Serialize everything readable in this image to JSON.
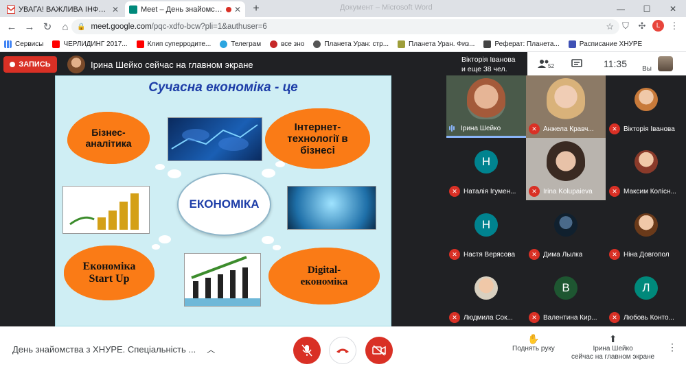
{
  "tabs": [
    {
      "title": "УВАГА! ВАЖЛИВА ІНФОРМАЦІЯ",
      "favicon_color": "#d93025",
      "active": false
    },
    {
      "title": "Meet – День знайомства з ХНУРЕ",
      "favicon_color": "#00897b",
      "active": true
    }
  ],
  "ghost_title": "Документ – Microsoft Word",
  "address": {
    "host": "meet.google.com",
    "path": "/pqc-xdfo-bcw?pli=1&authuser=6"
  },
  "profile_letter": "L",
  "bookmarks": [
    {
      "label": "Сервисы",
      "color": "#4285f4"
    },
    {
      "label": "ЧЕРЛИДИНГ 2017...",
      "color": "#ff0000"
    },
    {
      "label": "Клип суперродите...",
      "color": "#ff0000"
    },
    {
      "label": "Телеграм",
      "color": "#2ca5e0"
    },
    {
      "label": "все зно",
      "color": "#c62828"
    },
    {
      "label": "Планета Уран: стр...",
      "color": "#555555"
    },
    {
      "label": "Планета Уран. Физ...",
      "color": "#9e9e3a"
    },
    {
      "label": "Реферат: Планета...",
      "color": "#444444"
    },
    {
      "label": "Расписание ХНУРЕ",
      "color": "#3f51b5"
    }
  ],
  "meet": {
    "record_label": "ЗАПИСЬ",
    "presenter_banner": "Ірина Шейко сейчас на главном экране",
    "participants_line1": "Вікторія Іванова",
    "participants_line2": "и еще 38 чел.",
    "people_count": "52",
    "clock": "11:35",
    "you_label": "Вы",
    "colors": {
      "accent": "#d93025",
      "tile": "#3c4043",
      "bg": "#202124"
    }
  },
  "slide": {
    "title": "Сучасна економіка - це",
    "center": "ЕКОНОМІКА",
    "clouds": [
      "Бізнес-\nаналітика",
      "Інтернет-\nтехнології в\nбізнесі",
      "Економіка\nStart Up",
      "Digital-\nекономіка"
    ]
  },
  "tiles": [
    {
      "name": "Ірина Шейко",
      "type": "video",
      "muted": false,
      "speaking": true
    },
    {
      "name": "Анжела Кравч...",
      "type": "video",
      "muted": true
    },
    {
      "name": "Вікторія Іванова",
      "type": "photo",
      "muted": true
    },
    {
      "name": "Наталія Ігумен...",
      "type": "letter",
      "letter": "Н",
      "color": "#00838f",
      "muted": true
    },
    {
      "name": "Irina Kolupaieva",
      "type": "video",
      "muted": true
    },
    {
      "name": "Максим Колісн...",
      "type": "photo",
      "muted": true
    },
    {
      "name": "Настя Верясова",
      "type": "letter",
      "letter": "Н",
      "color": "#00838f",
      "muted": true
    },
    {
      "name": "Дима Лылка",
      "type": "photo",
      "muted": true
    },
    {
      "name": "Ніна Довгопол",
      "type": "photo",
      "muted": true
    },
    {
      "name": "Людмила Сок...",
      "type": "photo",
      "muted": true
    },
    {
      "name": "Валентина Кир...",
      "type": "letter",
      "letter": "В",
      "color": "#1e5631",
      "muted": true
    },
    {
      "name": "Любовь Конто...",
      "type": "letter",
      "letter": "Л",
      "color": "#00897b",
      "muted": true
    }
  ],
  "bottom": {
    "meeting_title": "День знайомства з ХНУРЕ. Спеціальність ...",
    "raise_hand": "Поднять руку",
    "present_line1": "Ірина Шейко",
    "present_line2": "сейчас на главном экране"
  }
}
